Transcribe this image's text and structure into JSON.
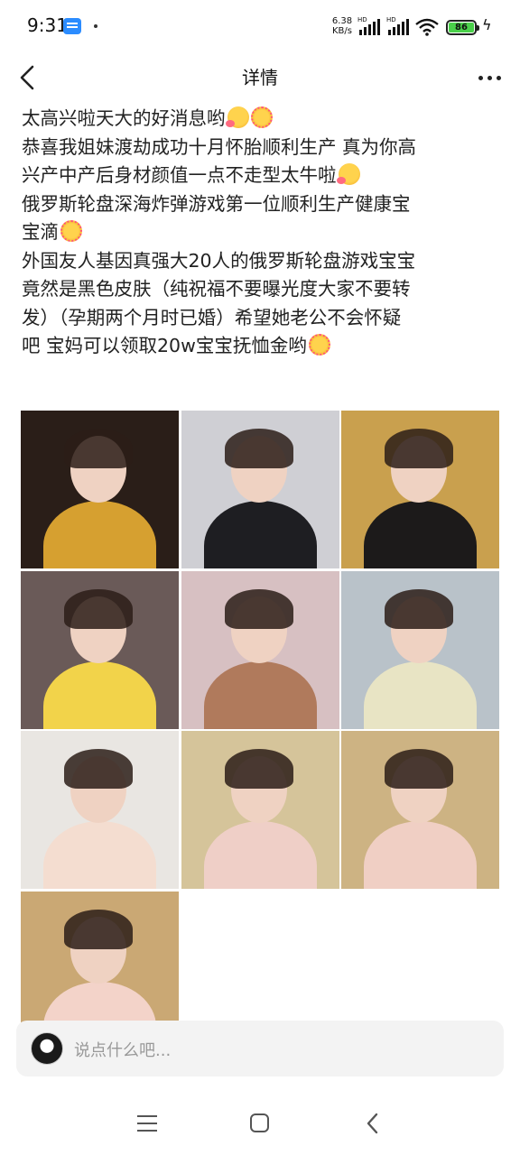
{
  "status_bar": {
    "time": "9:31",
    "net_speed_value": "6.38",
    "net_speed_unit": "KB/s",
    "signal_label_1": "HD",
    "signal_label_2": "HD",
    "battery": "86",
    "app_icon": "calendar-icon"
  },
  "header": {
    "title": "详情",
    "back_icon": "chevron-left-icon",
    "more_icon": "more-icon"
  },
  "post": {
    "lines": [
      "太高兴啦天大的好消息哟",
      "恭喜我姐妹渡劫成功十月怀胎顺利生产 真为你高",
      "兴产中产后身材颜值一点不走型太牛啦",
      "俄罗斯轮盘深海炸弹游戏第一位顺利生产健康宝",
      "宝滴",
      "外国友人基因真强大20人的俄罗斯轮盘游戏宝宝",
      "竟然是黑色皮肤（纯祝福不要曝光度大家不要转",
      "发）（孕期两个月时已婚）希望她老公不会怀疑",
      "吧 宝妈可以领取20w宝宝抚恤金哟"
    ]
  },
  "photos": [
    {
      "alt": "woman-glasses-mustard-top",
      "bg": "#2a1e18",
      "accent": "#d6a030"
    },
    {
      "alt": "woman-glasses-black-top",
      "bg": "#cfcfd4",
      "accent": "#1e1e22"
    },
    {
      "alt": "woman-glasses-sofa",
      "bg": "#c9a04e",
      "accent": "#1c1a1a"
    },
    {
      "alt": "woman-with-baby",
      "bg": "#6a5a58",
      "accent": "#f2d34a"
    },
    {
      "alt": "baby-closeup",
      "bg": "#d7c0c2",
      "accent": "#b07a5c"
    },
    {
      "alt": "baby-in-crib",
      "bg": "#b9c2c9",
      "accent": "#e8e4c4"
    },
    {
      "alt": "pregnant-belly",
      "bg": "#e9e6e2",
      "accent": "#f4ddd0"
    },
    {
      "alt": "maternity-photo-pink-dress",
      "bg": "#d5c49a",
      "accent": "#efcfc7"
    },
    {
      "alt": "maternity-photo-side",
      "bg": "#cdb383",
      "accent": "#f0cfc4"
    },
    {
      "alt": "maternity-photo-candle",
      "bg": "#caa874",
      "accent": "#f3d3c9"
    }
  ],
  "comment": {
    "placeholder": "说点什么吧..."
  },
  "nav": {
    "menu_icon": "menu-icon",
    "home_icon": "home-icon",
    "back_icon": "back-icon"
  }
}
